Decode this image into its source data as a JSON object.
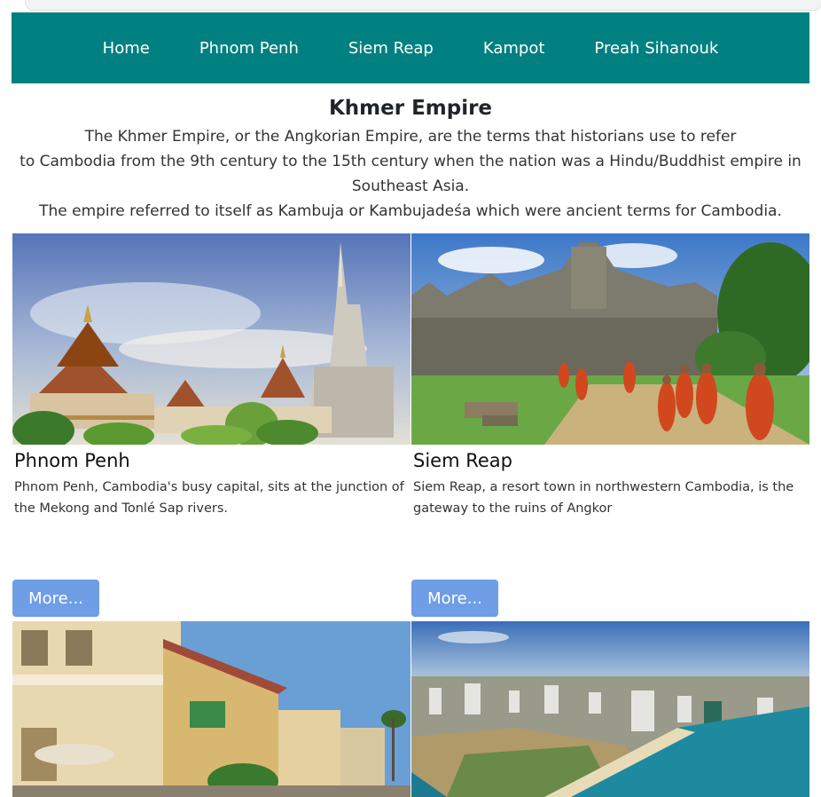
{
  "nav": {
    "items": [
      {
        "label": "Home"
      },
      {
        "label": "Phnom Penh"
      },
      {
        "label": "Siem Reap"
      },
      {
        "label": "Kampot"
      },
      {
        "label": "Preah Sihanouk"
      }
    ]
  },
  "intro": {
    "title": "Khmer Empire",
    "line1": "The Khmer Empire, or the Angkorian Empire, are the terms that historians use to refer",
    "line2": "to Cambodia from the 9th century to the 15th century when the nation was a Hindu/Buddhist empire in",
    "line3": "Southeast Asia.",
    "line4": "The empire referred to itself as Kambuja or Kambujadeśa which were ancient terms for Cambodia."
  },
  "cards": [
    {
      "title": "Phnom Penh",
      "description": "Phnom Penh, Cambodia's busy capital, sits at the junction of the Mekong and Tonlé Sap rivers.",
      "button": "More..."
    },
    {
      "title": "Siem Reap",
      "description": "Siem Reap, a resort town in northwestern Cambodia, is the gateway to the ruins of Angkor",
      "button": "More..."
    }
  ],
  "colors": {
    "nav_bg": "#008080",
    "button_bg": "#6f9de6"
  }
}
